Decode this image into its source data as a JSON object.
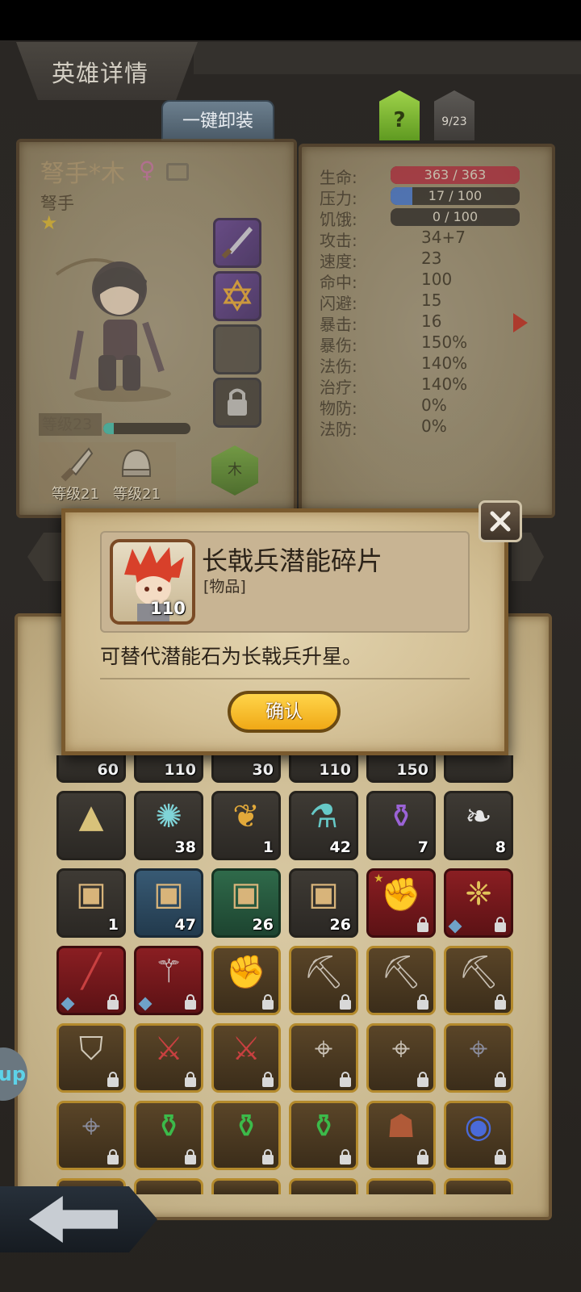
{
  "header": {
    "title": "英雄详情"
  },
  "toolbar": {
    "unequip_all_label": "一键卸装",
    "help_label": "?",
    "roster_count": "9/23"
  },
  "hero": {
    "name": "弩手*木",
    "class": "弩手",
    "stars": 1,
    "level_label": "等级23",
    "exp_fraction": 0.12,
    "element": "木",
    "equipment": [
      {
        "icon": "sword-icon",
        "level_label": "等级21"
      },
      {
        "icon": "helmet-icon",
        "level_label": "等级21"
      }
    ]
  },
  "stats": {
    "bars": [
      {
        "label": "生命:",
        "value": "363 / 363",
        "fraction": 1.0,
        "color": "#a8283a"
      },
      {
        "label": "压力:",
        "value": "17 / 100",
        "fraction": 0.17,
        "color": "#3c6ec8"
      },
      {
        "label": "饥饿:",
        "value": "0 / 100",
        "fraction": 0.0,
        "color": "#3c6ec8"
      }
    ],
    "rows": [
      {
        "label": "攻击:",
        "value": "34+7"
      },
      {
        "label": "速度:",
        "value": "23"
      },
      {
        "label": "命中:",
        "value": "100"
      },
      {
        "label": "闪避:",
        "value": "15"
      },
      {
        "label": "暴击:",
        "value": "16"
      },
      {
        "label": "暴伤:",
        "value": "150%"
      },
      {
        "label": "法伤:",
        "value": "140%"
      },
      {
        "label": "治疗:",
        "value": "140%"
      },
      {
        "label": "物防:",
        "value": "0%"
      },
      {
        "label": "法防:",
        "value": "0%"
      }
    ]
  },
  "modal": {
    "item_name": "长戟兵潜能碎片",
    "item_type": "[物品]",
    "item_count": "110",
    "description": "可替代潜能石为长戟兵升星。",
    "confirm_label": "确认"
  },
  "inventory": {
    "row0_counts": [
      "60",
      "110",
      "30",
      "110",
      "150",
      ""
    ],
    "rows": [
      [
        {
          "name": "mountain-ore-item",
          "glyph": "▲",
          "color": "#d8c27a",
          "count": "",
          "style": "dark"
        },
        {
          "name": "dark-rune-item",
          "glyph": "✺",
          "color": "#7fd4d8",
          "count": "38",
          "style": "dark"
        },
        {
          "name": "golden-horn-item",
          "glyph": "❦",
          "color": "#e2a93a",
          "count": "1",
          "style": "dark"
        },
        {
          "name": "teal-potion-item",
          "glyph": "⚗",
          "color": "#66c9c7",
          "count": "42",
          "style": "dark"
        },
        {
          "name": "purple-potion-item",
          "glyph": "⚱",
          "color": "#9b63d6",
          "count": "7",
          "style": "dark"
        },
        {
          "name": "feather-item",
          "glyph": "❧",
          "color": "#e6e6e6",
          "count": "8",
          "style": "dark"
        }
      ],
      [
        {
          "name": "wooden-chest-item",
          "glyph": "▣",
          "color": "#d8b47a",
          "count": "1",
          "style": "dark"
        },
        {
          "name": "blue-chest-item",
          "glyph": "▣",
          "color": "#d8b47a",
          "count": "47",
          "style": "blue"
        },
        {
          "name": "green-chest-item",
          "glyph": "▣",
          "color": "#d8b47a",
          "count": "26",
          "style": "green"
        },
        {
          "name": "gray-chest-item",
          "glyph": "▣",
          "color": "#d8b47a",
          "count": "26",
          "style": "dark"
        },
        {
          "name": "red-gauntlet-item",
          "glyph": "✊",
          "color": "#b8a8a8",
          "count": "",
          "style": "red",
          "locked": true,
          "star": true
        },
        {
          "name": "red-winged-staff-item",
          "glyph": "❈",
          "color": "#e2c45a",
          "count": "",
          "style": "red",
          "locked": true,
          "gem": true
        }
      ],
      [
        {
          "name": "red-spear-item",
          "glyph": "╱",
          "color": "#c84040",
          "count": "",
          "style": "red",
          "locked": true,
          "gem": true
        },
        {
          "name": "red-mace-item",
          "glyph": "⚚",
          "color": "#d8d8d8",
          "count": "",
          "style": "red",
          "locked": true,
          "gem": true
        },
        {
          "name": "gauntlet-item",
          "glyph": "✊",
          "color": "#a8a098",
          "count": "",
          "style": "gold",
          "locked": true
        },
        {
          "name": "pickaxe-item",
          "glyph": "⛏",
          "color": "#c8c0b4",
          "count": "",
          "style": "gold",
          "locked": true
        },
        {
          "name": "pickaxe-item",
          "glyph": "⛏",
          "color": "#c8c0b4",
          "count": "",
          "style": "gold",
          "locked": true
        },
        {
          "name": "pickaxe-item",
          "glyph": "⛏",
          "color": "#c8c0b4",
          "count": "",
          "style": "gold",
          "locked": true
        }
      ],
      [
        {
          "name": "shield-item",
          "glyph": "⛉",
          "color": "#d0c8b8",
          "count": "",
          "style": "gold",
          "locked": true
        },
        {
          "name": "crossed-swords-item",
          "glyph": "⚔",
          "color": "#c84040",
          "count": "",
          "style": "gold",
          "locked": true
        },
        {
          "name": "crossed-swords-item",
          "glyph": "⚔",
          "color": "#c84040",
          "count": "",
          "style": "gold",
          "locked": true
        },
        {
          "name": "crossbow-item",
          "glyph": "⌖",
          "color": "#c8c0b4",
          "count": "",
          "style": "gold",
          "locked": true
        },
        {
          "name": "crossbow-item",
          "glyph": "⌖",
          "color": "#c8c0b4",
          "count": "",
          "style": "gold",
          "locked": true
        },
        {
          "name": "dark-crossbow-item",
          "glyph": "⌖",
          "color": "#8a8c9c",
          "count": "",
          "style": "gold",
          "locked": true
        }
      ],
      [
        {
          "name": "dark-crossbow-item",
          "glyph": "⌖",
          "color": "#8a8c9c",
          "count": "",
          "style": "gold",
          "locked": true
        },
        {
          "name": "green-flask-item",
          "glyph": "⚱",
          "color": "#3cba4a",
          "count": "",
          "style": "gold",
          "locked": true
        },
        {
          "name": "green-flask-item",
          "glyph": "⚱",
          "color": "#3cba4a",
          "count": "",
          "style": "gold",
          "locked": true
        },
        {
          "name": "green-flask-item",
          "glyph": "⚱",
          "color": "#3cba4a",
          "count": "",
          "style": "gold",
          "locked": true
        },
        {
          "name": "leather-armor-item",
          "glyph": "☗",
          "color": "#b05a38",
          "count": "",
          "style": "gold",
          "locked": true
        },
        {
          "name": "blue-orb-item",
          "glyph": "◉",
          "color": "#4a6ad8",
          "count": "",
          "style": "gold",
          "locked": true
        }
      ]
    ]
  },
  "side_badge": {
    "label": "up"
  }
}
